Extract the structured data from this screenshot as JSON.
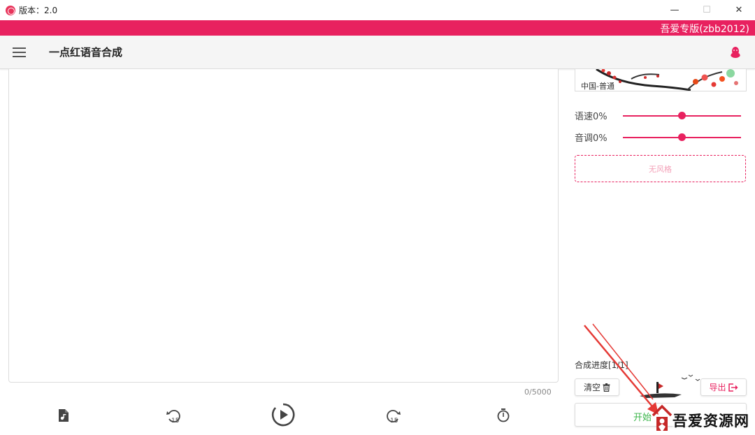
{
  "window": {
    "title": "版本：2.0",
    "controls": {
      "minimize": "—",
      "maximize": "☐",
      "close": "✕"
    }
  },
  "banner": {
    "text": "吾爱专版(zbb2012)"
  },
  "appbar": {
    "title": "一点红语音合成",
    "menu_icon": "menu-icon",
    "right_icon": "qq-icon"
  },
  "editor": {
    "text": "",
    "char_count": "0/5000"
  },
  "toolbar": {
    "buttons": [
      {
        "name": "import-audio",
        "icon": "file-music-icon"
      },
      {
        "name": "rewind-15",
        "icon": "rewind-15-icon",
        "label": "15"
      },
      {
        "name": "play",
        "icon": "play-circle-icon"
      },
      {
        "name": "forward-15",
        "icon": "forward-15-icon",
        "label": "15"
      },
      {
        "name": "timer",
        "icon": "timer-icon"
      }
    ]
  },
  "panel": {
    "voice_label": "中国-普通",
    "speed_label": "语速0%",
    "speed_value": 0.5,
    "pitch_label": "音调0%",
    "pitch_value": 0.5,
    "style_label": "无风格",
    "progress_label": "合成进度[1/1]",
    "clear_label": "清空",
    "export_label": "导出",
    "start_label": "开始"
  },
  "watermark": {
    "text": "吾爱资源网"
  },
  "colors": {
    "accent": "#e8215f",
    "start_text": "#3bb54a"
  }
}
